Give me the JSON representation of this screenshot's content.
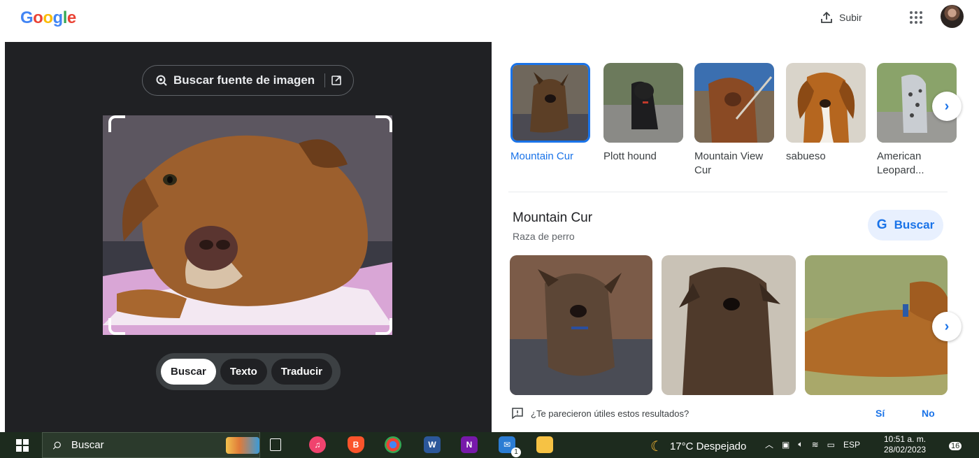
{
  "header": {
    "logo_letters": [
      {
        "ch": "G",
        "color": "#4285F4"
      },
      {
        "ch": "o",
        "color": "#EA4335"
      },
      {
        "ch": "o",
        "color": "#FBBC05"
      },
      {
        "ch": "g",
        "color": "#4285F4"
      },
      {
        "ch": "l",
        "color": "#34A853"
      },
      {
        "ch": "e",
        "color": "#EA4335"
      }
    ],
    "upload_label": "Subir",
    "upload_icon": "upload-icon",
    "apps_icon": "apps-grid-icon"
  },
  "lens": {
    "source_button_label": "Buscar fuente de imagen",
    "modes": [
      {
        "label": "Buscar",
        "active": true
      },
      {
        "label": "Texto",
        "active": false
      },
      {
        "label": "Traducir",
        "active": false
      }
    ]
  },
  "results": {
    "visual_matches": [
      {
        "label": "Mountain Cur",
        "selected": true
      },
      {
        "label": "Plott hound",
        "selected": false
      },
      {
        "label": "Mountain View Cur",
        "selected": false
      },
      {
        "label": "sabueso",
        "selected": false
      },
      {
        "label": "American Leopard...",
        "selected": false
      }
    ],
    "knowledge": {
      "title": "Mountain Cur",
      "subtitle": "Raza de perro",
      "search_button": "Buscar"
    },
    "feedback": {
      "question": "¿Te parecieron útiles estos resultados?",
      "yes": "Sí",
      "no": "No"
    }
  },
  "taskbar": {
    "search_placeholder": "Buscar",
    "weather": "17°C  Despejado",
    "language": "ESP",
    "time": "10:51 a. m.",
    "date": "28/02/2023",
    "mail_badge": "1",
    "notifications_badge": "16"
  },
  "colors": {
    "accent": "#1a73e8",
    "lens_bg": "#202124",
    "taskbar_bg": "#1d2b1e"
  }
}
